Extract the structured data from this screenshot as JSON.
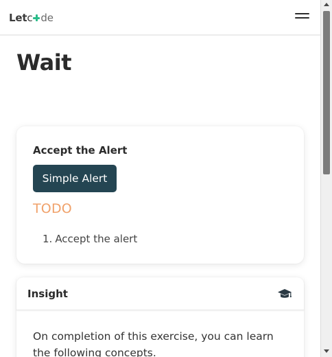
{
  "logo": {
    "part1": "Let",
    "part2": "c",
    "part3": "de"
  },
  "navbar": {
    "menu_icon": "hamburger-menu-icon"
  },
  "page": {
    "title": "Wait"
  },
  "alert_card": {
    "label": "Accept the Alert",
    "button_label": "Simple Alert",
    "todo_heading": "TODO",
    "steps": [
      {
        "number": "1.",
        "text": "Accept the alert"
      }
    ]
  },
  "insight_card": {
    "title": "Insight",
    "icon": "graduation-cap-icon",
    "body": "On completion of this exercise, you can learn the following concepts."
  },
  "colors": {
    "button_bg": "#244552",
    "todo": "#f0a16a",
    "logo_accent": "#2bbc8a"
  }
}
